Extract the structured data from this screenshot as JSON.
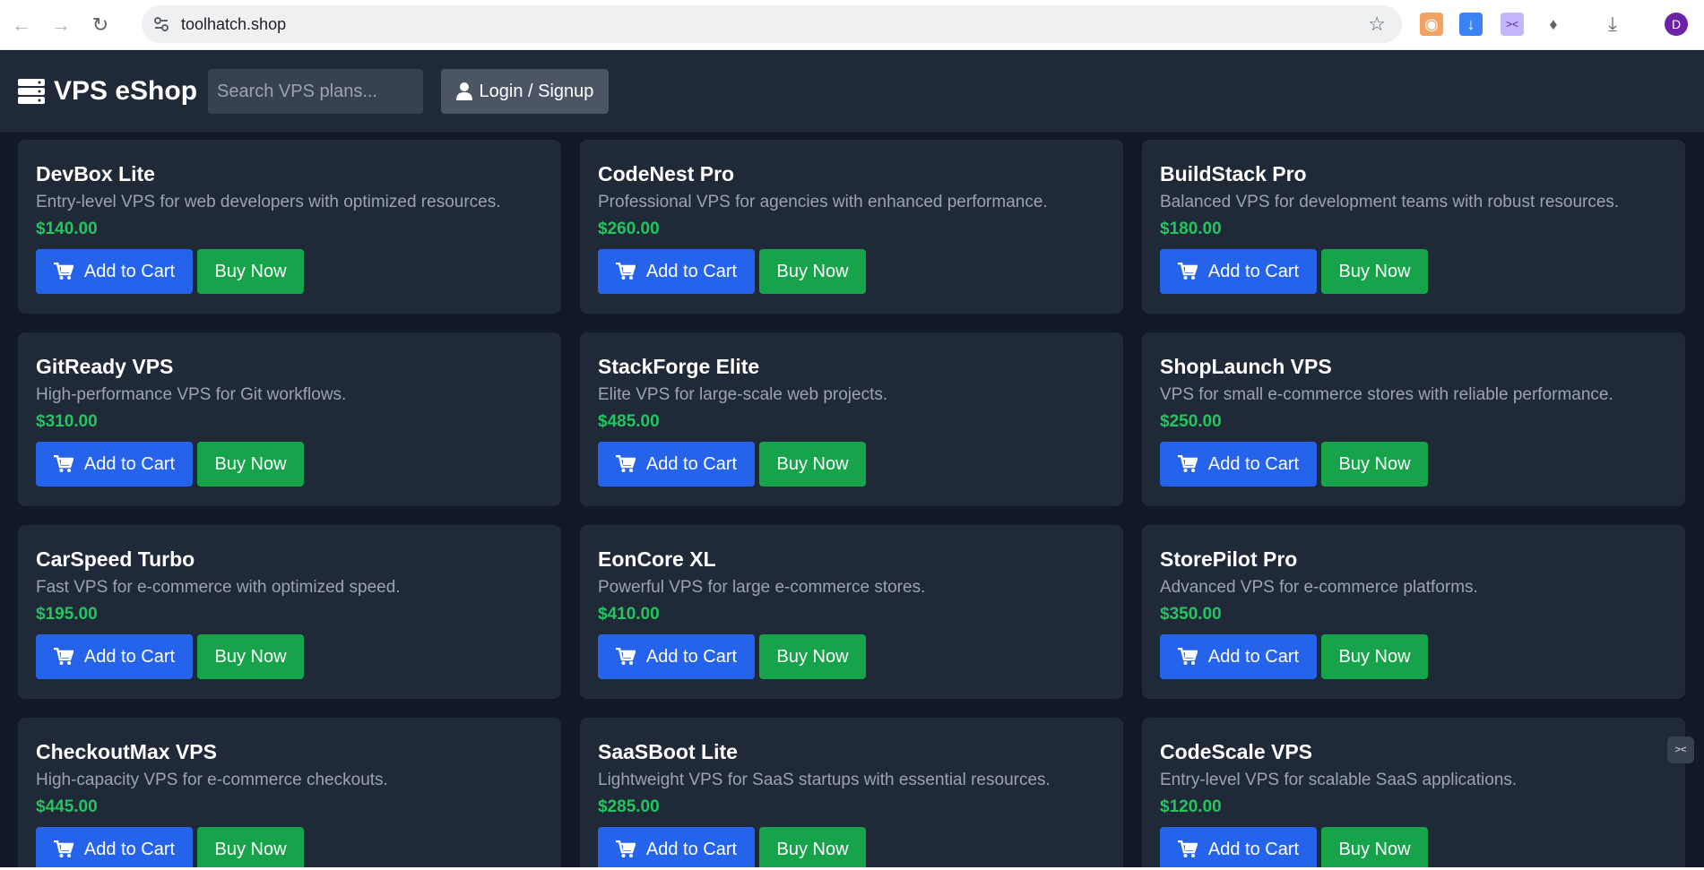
{
  "browser": {
    "url": "toolhatch.shop",
    "icons": [
      "back-arrow-icon",
      "forward-arrow-icon",
      "reload-icon",
      "site-info-icon",
      "bookmark-star-icon",
      "extension-icons",
      "downloads-icon",
      "profile-avatar"
    ],
    "avatar_letter": "D"
  },
  "header": {
    "brand": "VPS eShop",
    "search_placeholder": "Search VPS plans...",
    "login_label": "Login / Signup"
  },
  "buttons": {
    "add_to_cart": "Add to Cart",
    "buy_now": "Buy Now"
  },
  "products": [
    {
      "name": "DevBox Lite",
      "description": "Entry-level VPS for web developers with optimized resources.",
      "price": "$140.00"
    },
    {
      "name": "CodeNest Pro",
      "description": "Professional VPS for agencies with enhanced performance.",
      "price": "$260.00"
    },
    {
      "name": "BuildStack Pro",
      "description": "Balanced VPS for development teams with robust resources.",
      "price": "$180.00"
    },
    {
      "name": "GitReady VPS",
      "description": "High-performance VPS for Git workflows.",
      "price": "$310.00"
    },
    {
      "name": "StackForge Elite",
      "description": "Elite VPS for large-scale web projects.",
      "price": "$485.00"
    },
    {
      "name": "ShopLaunch VPS",
      "description": "VPS for small e-commerce stores with reliable performance.",
      "price": "$250.00"
    },
    {
      "name": "CarSpeed Turbo",
      "description": "Fast VPS for e-commerce with optimized speed.",
      "price": "$195.00"
    },
    {
      "name": "EonCore XL",
      "description": "Powerful VPS for large e-commerce stores.",
      "price": "$410.00"
    },
    {
      "name": "StorePilot Pro",
      "description": "Advanced VPS for e-commerce platforms.",
      "price": "$350.00"
    },
    {
      "name": "CheckoutMax VPS",
      "description": "High-capacity VPS for e-commerce checkouts.",
      "price": "$445.00"
    },
    {
      "name": "SaaSBoot Lite",
      "description": "Lightweight VPS for SaaS startups with essential resources.",
      "price": "$285.00"
    },
    {
      "name": "CodeScale VPS",
      "description": "Entry-level VPS for scalable SaaS applications.",
      "price": "$120.00"
    }
  ],
  "colors": {
    "page_bg": "#111827",
    "card_bg": "#1f2937",
    "price": "#22c55e",
    "cart_button": "#2563eb",
    "buy_button": "#16a34a",
    "login_button": "#4b5563"
  }
}
